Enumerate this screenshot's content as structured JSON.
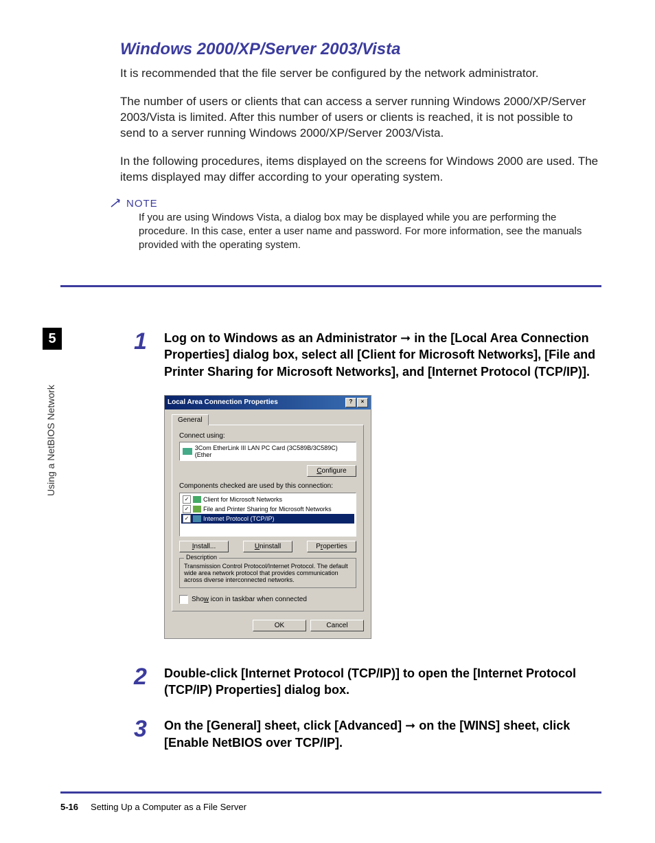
{
  "sidebar": {
    "chapter_number": "5",
    "chapter_title": "Using a NetBIOS Network"
  },
  "heading": "Windows 2000/XP/Server 2003/Vista",
  "paragraphs": {
    "p1": "It is recommended that the file server be configured by the network administrator.",
    "p2": "The number of users or clients that can access a server running Windows 2000/XP/Server 2003/Vista is limited. After this number of users or clients is reached, it is not possible to send to a server running Windows 2000/XP/Server 2003/Vista.",
    "p3": "In the following procedures, items displayed on the screens for Windows 2000 are used. The items displayed may differ according to your operating system."
  },
  "note": {
    "label": "NOTE",
    "text": "If you are using Windows Vista, a dialog box may be displayed while you are performing the procedure. In this case, enter a user name and password. For more information, see the manuals provided with the operating system."
  },
  "steps": {
    "s1": {
      "num": "1",
      "text_a": "Log on to Windows as an Administrator ",
      "text_b": " in the [Local Area Connection Properties] dialog box, select all [Client for Microsoft Networks], [File and Printer Sharing for Microsoft Networks], and [Internet Protocol (TCP/IP)]."
    },
    "s2": {
      "num": "2",
      "text": "Double-click [Internet Protocol (TCP/IP)] to open the [Internet Protocol (TCP/IP) Properties] dialog box."
    },
    "s3": {
      "num": "3",
      "text_a": "On the [General] sheet, click [Advanced] ",
      "text_b": " on the [WINS] sheet, click [Enable NetBIOS over TCP/IP]."
    }
  },
  "dialog": {
    "title": "Local Area Connection Properties",
    "tab": "General",
    "connect_label": "Connect using:",
    "adapter": "3Com EtherLink III LAN PC Card (3C589B/3C589C) (Ether",
    "configure": "Configure",
    "components_label": "Components checked are used by this connection:",
    "items": {
      "client": "Client for Microsoft Networks",
      "share": "File and Printer Sharing for Microsoft Networks",
      "proto": "Internet Protocol (TCP/IP)"
    },
    "install": "Install...",
    "uninstall": "Uninstall",
    "properties": "Properties",
    "desc_label": "Description",
    "desc_text": "Transmission Control Protocol/Internet Protocol. The default wide area network protocol that provides communication across diverse interconnected networks.",
    "show_icon": "Show icon in taskbar when connected",
    "ok": "OK",
    "cancel": "Cancel",
    "help": "?",
    "close": "×"
  },
  "footer": {
    "page": "5-16",
    "title": "Setting Up a Computer as a File Server"
  }
}
